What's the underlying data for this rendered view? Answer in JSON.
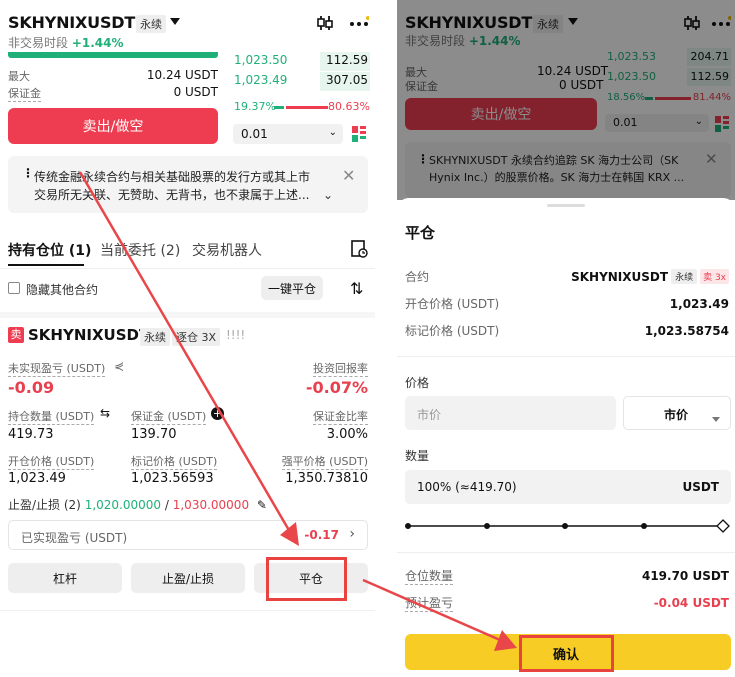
{
  "left": {
    "symbol": "SKHYNIXUSDT",
    "perp_tag": "永续",
    "session": "非交易时段",
    "change": "+1.44%",
    "orderbook": [
      {
        "price": "1,023.50",
        "size": "112.59"
      },
      {
        "price": "1,023.49",
        "size": "307.05"
      }
    ],
    "max_label": "最大",
    "max_value": "10.24 USDT",
    "margin_label": "保证金",
    "margin_value": "0 USDT",
    "ratio_buy": "19.37%",
    "ratio_sell": "80.63%",
    "sell_button": "卖出/做空",
    "precision": "0.01",
    "notice_line1": "传统金融永续合约与相关基础股票的发行方或其上市",
    "notice_line2": "交易所无关联、无赞助、无背书，也不隶属于上述...",
    "tabs": [
      "持有仓位 (1)",
      "当前委托 (2)",
      "交易机器人"
    ],
    "hide_other": "隐藏其他合约",
    "close_all": "一键平仓",
    "position": {
      "side": "卖",
      "symbol": "SKHYNIXUSDT",
      "perp": "永续",
      "mode": "逐仓 3X",
      "bars": "!!!!",
      "unrealized_label": "未实现盈亏 (USDT)",
      "unrealized_value": "-0.09",
      "roi_label": "投资回报率",
      "roi_value": "-0.07%",
      "qty_label": "持仓数量 (USDT)",
      "qty_value": "419.73",
      "margin_label": "保证金 (USDT)",
      "margin_value": "139.70",
      "margin_ratio_label": "保证金比率",
      "margin_ratio_value": "3.00%",
      "entry_label": "开仓价格 (USDT)",
      "entry_value": "1,023.49",
      "mark_label": "标记价格 (USDT)",
      "mark_value": "1,023.56593",
      "liq_label": "强平价格 (USDT)",
      "liq_value": "1,350.73810",
      "tpsl_label": "止盈/止损 (2)",
      "tp_value": "1,020.00000",
      "sl_value": "1,030.00000",
      "realized_label": "已实现盈亏 (USDT)",
      "realized_value": "-0.17",
      "btn_leverage": "杠杆",
      "btn_tpsl": "止盈/止损",
      "btn_close": "平仓"
    }
  },
  "right": {
    "symbol": "SKHYNIXUSDT",
    "perp_tag": "永续",
    "session": "非交易时段",
    "change": "+1.44%",
    "orderbook": [
      {
        "price": "1,023.53",
        "size": "204.71"
      },
      {
        "price": "1,023.50",
        "size": "112.59"
      }
    ],
    "max_label": "最大",
    "max_value": "10.24 USDT",
    "margin_label": "保证金",
    "margin_value": "0 USDT",
    "ratio_buy": "18.56%",
    "ratio_sell": "81.44%",
    "sell_button": "卖出/做空",
    "precision": "0.01",
    "notice_line1": "SKHYNIXUSDT 永续合约追踪 SK 海力士公司（SK",
    "notice_line2": "Hynix Inc.）的股票价格。SK 海力士在韩国 KRX ...",
    "sheet": {
      "title": "平仓",
      "contract_label": "合约",
      "contract_value": "SKHYNIXUSDT",
      "contract_perp": "永续",
      "contract_side": "卖 3x",
      "entry_label": "开仓价格 (USDT)",
      "entry_value": "1,023.49",
      "mark_label": "标记价格 (USDT)",
      "mark_value": "1,023.58754",
      "price_label": "价格",
      "price_placeholder": "市价",
      "price_type": "市价",
      "qty_label": "数量",
      "qty_value": "100% (≈419.70)",
      "qty_unit": "USDT",
      "pos_qty_label": "仓位数量",
      "pos_qty_value": "419.70 USDT",
      "est_pnl_label": "预计盈亏",
      "est_pnl_value": "-0.04 USDT",
      "confirm": "确认"
    }
  }
}
